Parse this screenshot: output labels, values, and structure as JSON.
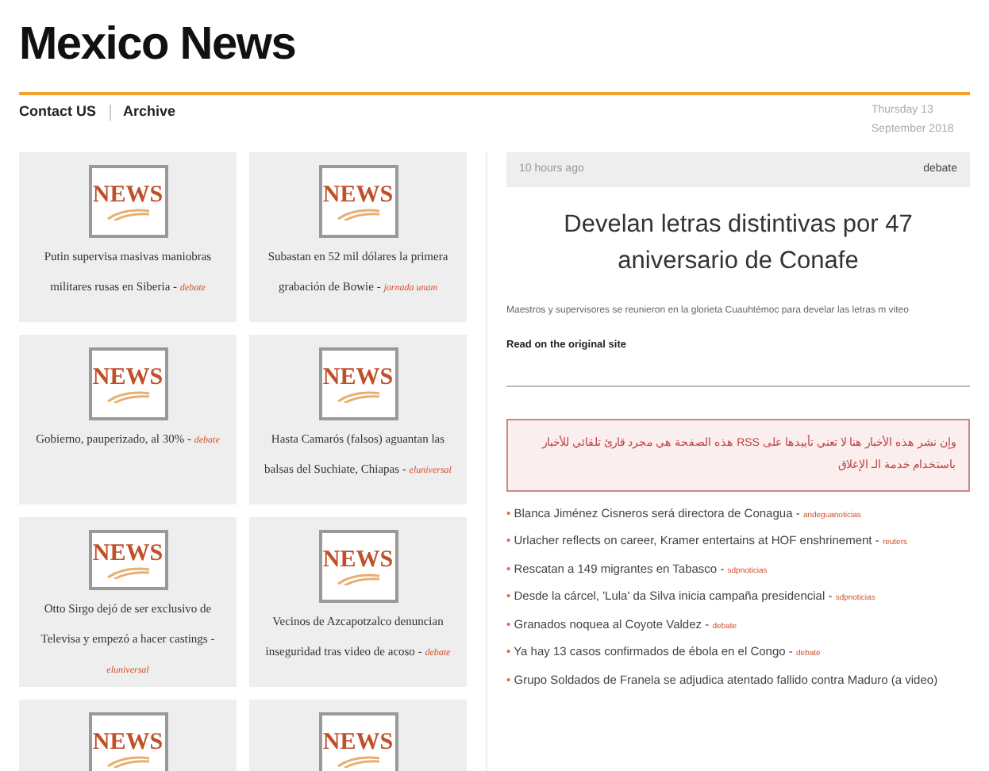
{
  "site_title": "Mexico News",
  "nav": [
    {
      "label": "Contact US"
    },
    {
      "label": "Archive"
    }
  ],
  "date": "Thursday 13 September 2018",
  "tiles": [
    {
      "logo": "NEWS",
      "headline": "Putin supervisa masivas maniobras militares rusas en Siberia",
      "source": "debate"
    },
    {
      "logo": "NEWS",
      "headline": "Subastan en 52 mil dólares la primera grabación de Bowie",
      "source": "jornada unam"
    },
    {
      "logo": "NEWS",
      "headline": "Gobierno, pauperizado, al 30%",
      "source": "debate"
    },
    {
      "logo": "NEWS",
      "headline": "Hasta Camarós (falsos) aguantan las balsas del Suchiate, Chiapas",
      "source": "eluniversal"
    },
    {
      "logo": "NEWS",
      "headline": "Otto Sirgo dejó de ser exclusivo de Televisa y empezó a hacer castings",
      "source": "eluniversal"
    },
    {
      "logo": "NEWS",
      "headline": "Vecinos de Azcapotzalco denuncian inseguridad tras video de acoso",
      "source": "debate"
    },
    {
      "logo": "NEWS"
    },
    {
      "logo": "NEWS"
    }
  ],
  "article": {
    "time": "10 hours ago",
    "source": "debate",
    "title": "Develan letras distintivas por 47 aniversario de Conafe",
    "summary": "Maestros y supervisores se reunieron en la glorieta Cuauhtémoc para develar las letras m viteo",
    "link": "Read on the original site"
  },
  "notice": "وإن نشر هذه الأخبار هنا لا تعني تأييدها على RSS هذه الصفحة هي مجرد قارئ تلقائي للأخبار باستخدام خدمة الـ الإغلاق",
  "headlines": [
    {
      "bullet": "•",
      "text": "Blanca Jiménez Cisneros será directora de Conagua",
      "source": "andeguanoticias"
    },
    {
      "bullet": "•",
      "text": "Urlacher reflects on career, Kramer entertains at HOF enshrinement",
      "source": "reuters"
    },
    {
      "bullet": "•",
      "text": "Rescatan a 149 migrantes en Tabasco",
      "source": "sdpnoticias"
    },
    {
      "bullet": "•",
      "text": "Desde la cárcel, 'Lula' da Silva inicia campaña presidencial",
      "source": "sdpnoticias"
    },
    {
      "bullet": "•",
      "text": "Granados noquea al Coyote Valdez",
      "source": "debate"
    },
    {
      "bullet": "•",
      "text": "Ya hay 13 casos confirmados de ébola en el Congo",
      "source": "debate"
    },
    {
      "bullet": "•",
      "text": "Grupo Soldados de Franela se adjudica atentado fallido contra Maduro (a video)"
    }
  ],
  "separator": "-"
}
